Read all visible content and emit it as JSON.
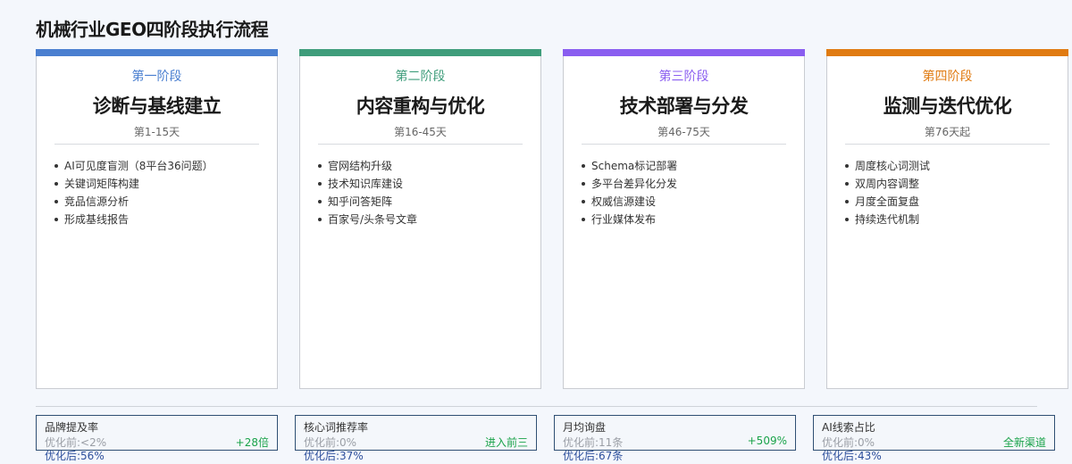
{
  "page": {
    "title": "机械行业GEO四阶段执行流程"
  },
  "colors": {
    "phase1": "#4a7fd0",
    "phase2": "#3f9d7b",
    "phase3": "#8a5ef0",
    "phase4": "#e07b12",
    "positive": "#1aa34a",
    "after": "#2d4f9c"
  },
  "phases": [
    {
      "label": "第一阶段",
      "name": "诊断与基线建立",
      "period": "第1-15天",
      "tasks": [
        "AI可见度盲测（8平台36问题）",
        "关键词矩阵构建",
        "竞品信源分析",
        "形成基线报告"
      ]
    },
    {
      "label": "第二阶段",
      "name": "内容重构与优化",
      "period": "第16-45天",
      "tasks": [
        "官网结构升级",
        "技术知识库建设",
        "知乎问答矩阵",
        "百家号/头条号文章"
      ]
    },
    {
      "label": "第三阶段",
      "name": "技术部署与分发",
      "period": "第46-75天",
      "tasks": [
        "Schema标记部署",
        "多平台差异化分发",
        "权威信源建设",
        "行业媒体发布"
      ]
    },
    {
      "label": "第四阶段",
      "name": "监测与迭代优化",
      "period": "第76天起",
      "tasks": [
        "周度核心词测试",
        "双周内容调整",
        "月度全面复盘",
        "持续迭代机制"
      ]
    }
  ],
  "metrics": [
    {
      "title": "品牌提及率",
      "before": "优化前:<2%",
      "after": "优化后:56%",
      "change": "+28倍"
    },
    {
      "title": "核心词推荐率",
      "before": "优化前:0%",
      "after": "优化后:37%",
      "change": "进入前三"
    },
    {
      "title": "月均询盘",
      "before": "优化前:11条",
      "after": "优化后:67条",
      "change": "+509%"
    },
    {
      "title": "AI线索占比",
      "before": "优化前:0%",
      "after": "优化后:43%",
      "change": "全新渠道"
    }
  ]
}
